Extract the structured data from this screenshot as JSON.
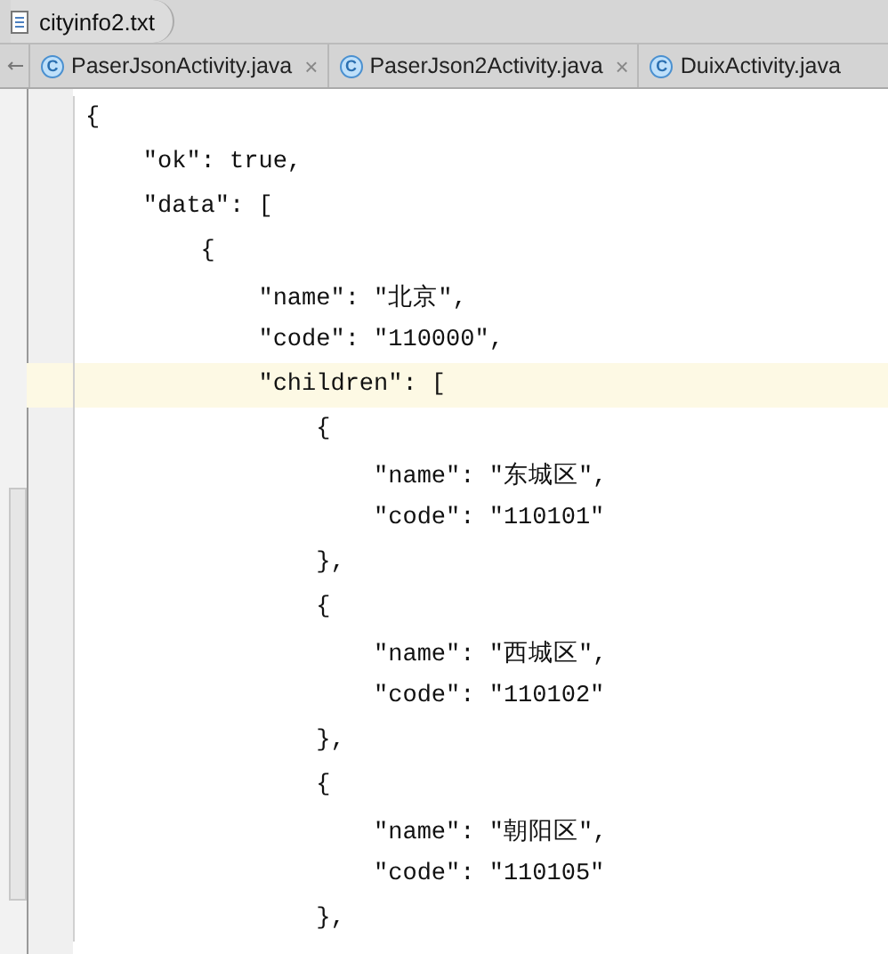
{
  "breadcrumb": {
    "file": "cityinfo2.txt"
  },
  "tabs": [
    {
      "label": "PaserJsonActivity.java",
      "icon": "C",
      "close": "×",
      "selected": false
    },
    {
      "label": "PaserJson2Activity.java",
      "icon": "C",
      "close": "×",
      "selected": false
    },
    {
      "label": "DuixActivity.java",
      "icon": "C",
      "selected": false
    }
  ],
  "lines": [
    {
      "text": "{",
      "highlighted": false
    },
    {
      "text": "    \"ok\": true,",
      "highlighted": false
    },
    {
      "text": "    \"data\": [",
      "highlighted": false
    },
    {
      "text": "        {",
      "highlighted": false
    },
    {
      "text": "            \"name\": \"北京\",",
      "highlighted": false
    },
    {
      "text": "            \"code\": \"110000\",",
      "highlighted": false
    },
    {
      "text": "            \"children\": [",
      "highlighted": true
    },
    {
      "text": "                {",
      "highlighted": false
    },
    {
      "text": "                    \"name\": \"东城区\",",
      "highlighted": false
    },
    {
      "text": "                    \"code\": \"110101\"",
      "highlighted": false
    },
    {
      "text": "                },",
      "highlighted": false
    },
    {
      "text": "                {",
      "highlighted": false
    },
    {
      "text": "                    \"name\": \"西城区\",",
      "highlighted": false
    },
    {
      "text": "                    \"code\": \"110102\"",
      "highlighted": false
    },
    {
      "text": "                },",
      "highlighted": false
    },
    {
      "text": "                {",
      "highlighted": false
    },
    {
      "text": "                    \"name\": \"朝阳区\",",
      "highlighted": false
    },
    {
      "text": "                    \"code\": \"110105\"",
      "highlighted": false
    },
    {
      "text": "                },",
      "highlighted": false
    }
  ]
}
